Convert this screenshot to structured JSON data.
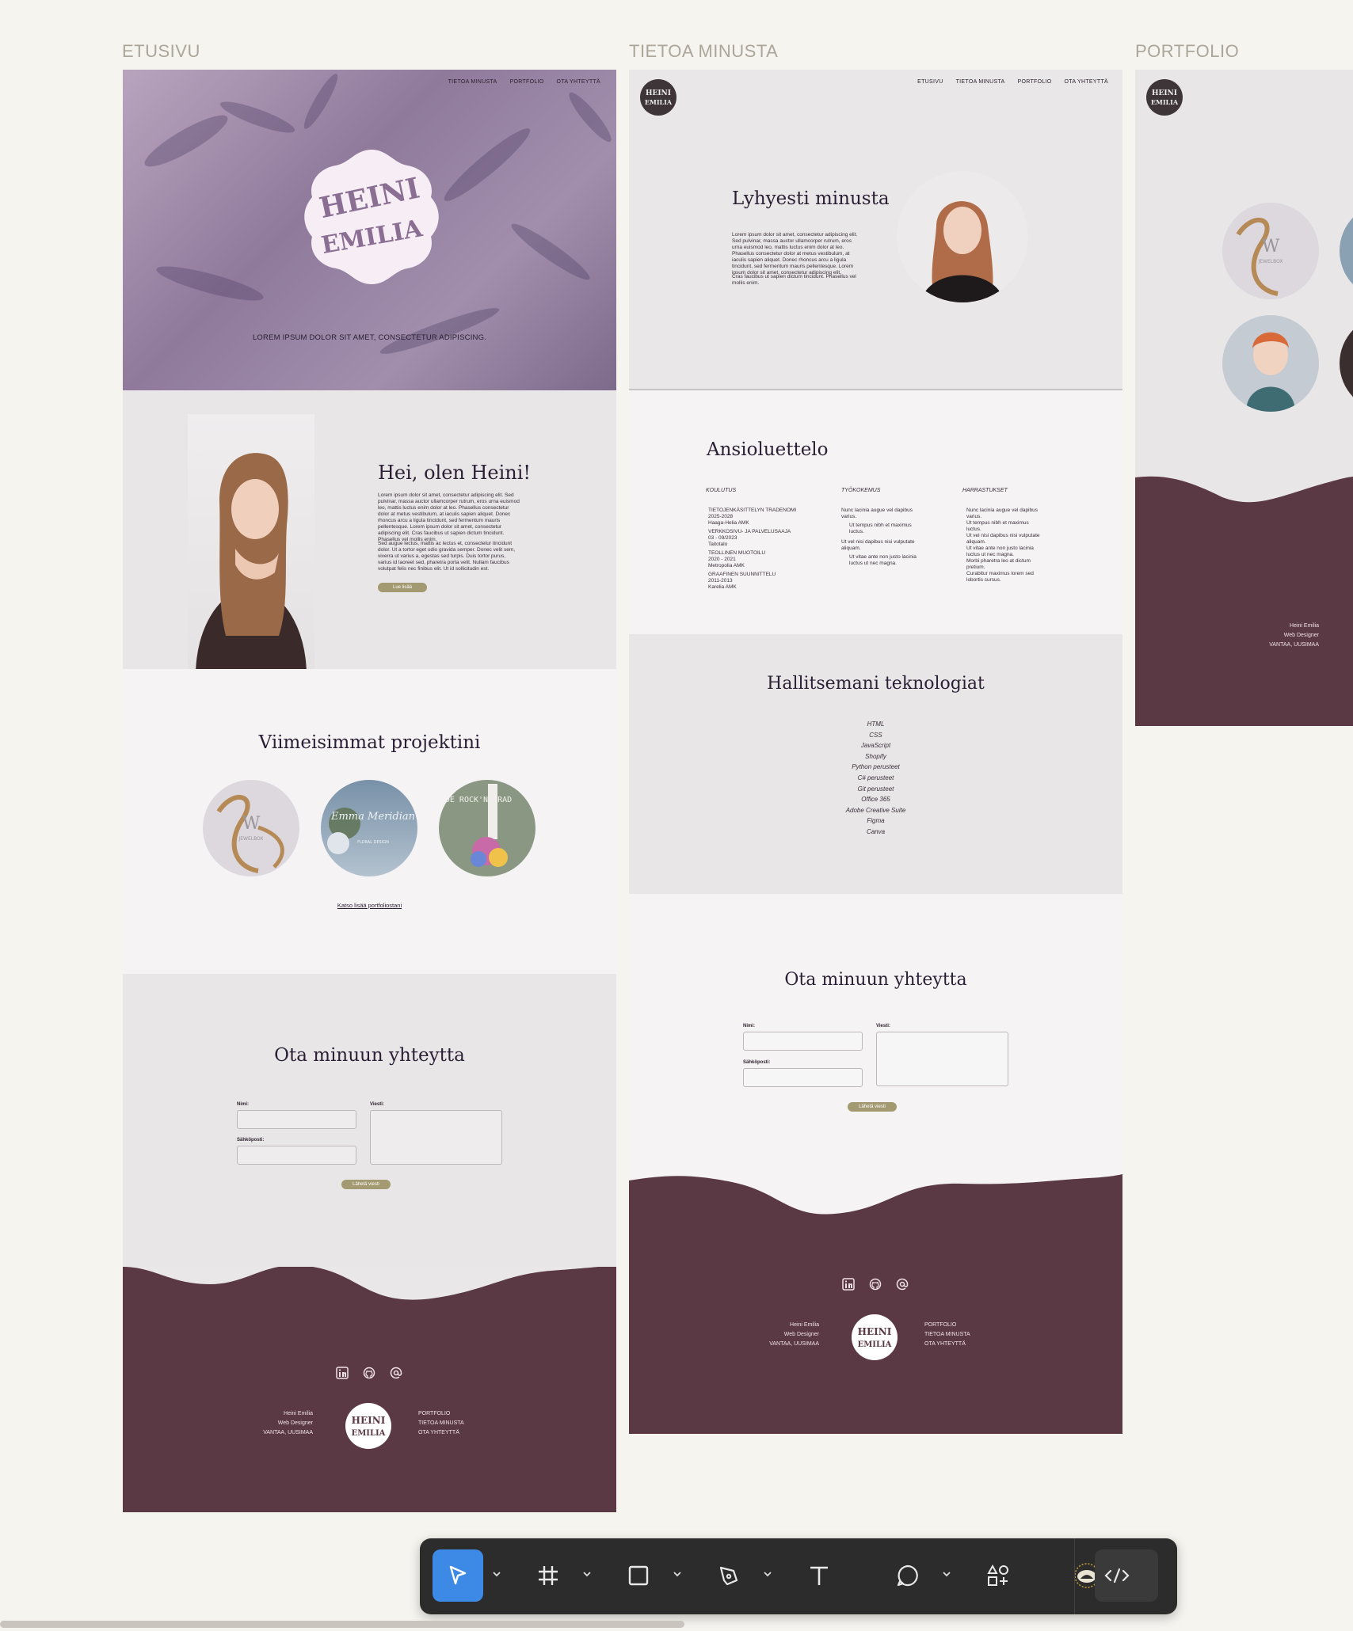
{
  "frames": {
    "etusivu": {
      "label": "ETUSIVU",
      "nav": [
        "TIETOA MINUSTA",
        "PORTFOLIO",
        "OTA YHTEYTTÄ"
      ],
      "hero_tagline": "LOREM IPSUM DOLOR SIT AMET, CONSECTETUR ADIPISCING.",
      "intro_title": "Hei, olen Heini!",
      "intro_p1": "Lorem ipsum dolor sit amet, consectetur adipiscing elit. Sed pulvinar, massa auctor ullamcorper rutrum, eros urna euismod leo, mattis luctus enim dolor at leo. Phasellus consectetur dolor at metus vestibulum, at iaculis sapien aliquet. Donec rhoncus arcu a ligula tincidunt, sed fermentum mauris pellentesque. Lorem ipsum dolor sit amet, consectetur adipiscing elit. Cras faucibus ut sapien dictum tincidunt. Phasellus vel mollis enim.",
      "intro_p2": "Sed augue lectus, mattis ac lectus et, consectetur tincidunt dolor. Ut a tortor eget odio gravida semper. Donec velit sem, viverra ut varius a, egestas sed turpis. Duis tortor purus, varius id laoreet sed, pharetra porta velit. Nullam faucibus volutpat felis nec finibus elit. Ut id sollicitudin est.",
      "read_more": "Lue lisää",
      "projects_title": "Viimeisimmat projektini",
      "portfolio_link": "Katso lisää portfoliostani",
      "contact_title": "Ota minuun yhteytta",
      "form": {
        "name": "Nimi:",
        "email": "Sähköposti:",
        "message": "Viesti:",
        "send": "Lähetä viesti"
      },
      "footer": {
        "name": "Heini Emilia",
        "role": "Web Designer",
        "place": "VANTAA, UUSIMAA",
        "links": [
          "PORTFOLIO",
          "TIETOA MINUSTA",
          "OTA YHTEYTTÄ"
        ]
      }
    },
    "tietoa": {
      "label": "TIETOA MINUSTA",
      "nav": [
        "ETUSIVU",
        "TIETOA MINUSTA",
        "PORTFOLIO",
        "OTA YHTEYTTÄ"
      ],
      "about_title": "Lyhyesti minusta",
      "about_p1": "Lorem ipsum dolor sit amet, consectetur adipiscing elit. Sed pulvinar, massa auctor ullamcorper rutrum, eros urna euismod leo, mattis luctus enim dolor at leo. Phasellus consectetur dolor at metus vestibulum, at iaculis sapien aliquet. Donec rhoncus arcu a ligula tincidunt, sed fermentum mauris pellentesque. Lorem ipsum dolor sit amet, consectetur adipiscing elit.",
      "about_p2": "Cras faucibus ut sapien dictum tincidunt. Phasellus vel mollis enim.",
      "cv_title": "Ansioluettelo",
      "cv_headers": [
        "KOULUTUS",
        "TYÖKOKEMUS",
        "HARRASTUKSET"
      ],
      "koulutus": [
        {
          "t": "TIETOJENKÄSITTELYN TRADENOMI",
          "d": "2025-2028",
          "s": "Haaga-Helia AMK"
        },
        {
          "t": "VERKKOSIVU- JA PALVELUSAAJA",
          "d": "03 - 09/2023",
          "s": "Taitotalo"
        },
        {
          "t": "TEOLLINEN MUOTOILU",
          "d": "2020 - 2021",
          "s": "Metropolia AMK"
        },
        {
          "t": "GRAAFINEN SUUNNITTELU",
          "d": "2011-2013",
          "s": "Karelia AMK"
        }
      ],
      "tyokokemus": [
        "Nunc lacinia augue vel dapibus varius.",
        "Ut tempus nibh et maximus luctus.",
        "Ut vel nisi dapibus nisi vulputate aliquam.",
        "Ut vitae ante non justo lacinia luctus ut nec magna."
      ],
      "harrastukset": [
        "Nunc lacinia augue vel dapibus varius.",
        "Ut tempus nibh et maximus luctus.",
        "Ut vel nisi dapibus nisi vulputate aliquam.",
        "Ut vitae ante non justo lacinia luctus ut nec magna.",
        "Morbi pharetra leo at dictum pretium.",
        "Curabitur maximus lorem sed lobortis cursus."
      ],
      "tech_title": "Hallitsemani teknologiat",
      "tech": [
        "HTML",
        "CSS",
        "JavaScript",
        "Shopify",
        "Python perusteet",
        "C# perusteet",
        "Git perusteet",
        "Office 365",
        "Adobe Creative Suite",
        "Figma",
        "Canva"
      ],
      "contact_title": "Ota minuun yhteytta",
      "form": {
        "name": "Nimi:",
        "email": "Sähköposti:",
        "message": "Viesti:",
        "send": "Lähetä viesti"
      },
      "footer": {
        "name": "Heini Emilia",
        "role": "Web Designer",
        "place": "VANTAA, UUSIMAA",
        "links": [
          "PORTFOLIO",
          "TIETOA MINUSTA",
          "OTA YHTEYTTÄ"
        ]
      }
    },
    "portfolio": {
      "label": "PORTFOLIO",
      "footer": {
        "name": "Heini Emilia",
        "role": "Web Designer",
        "place": "VANTAA, UUSIMAA"
      }
    }
  },
  "logo_text": "HEINI EMILIA",
  "project_thumbs": [
    {
      "name": "W",
      "sub": "JEWELBOX"
    },
    {
      "name": "Emma Meridian",
      "sub": "FLORAL DESIGN"
    },
    {
      "name": "JOE ROCK'N TRAD",
      "sub": ""
    }
  ],
  "colors": {
    "plum": "#5a3844",
    "olive": "#a39a72",
    "canvas": "#f6f4ef",
    "accent_blue": "#3d8ae6"
  },
  "toolbar": {
    "tools": [
      "move-tool",
      "frame-tool",
      "shape-tool",
      "pen-tool",
      "text-tool",
      "comment-tool",
      "assets-tool",
      "ai-tool",
      "dev-mode-toggle"
    ]
  }
}
